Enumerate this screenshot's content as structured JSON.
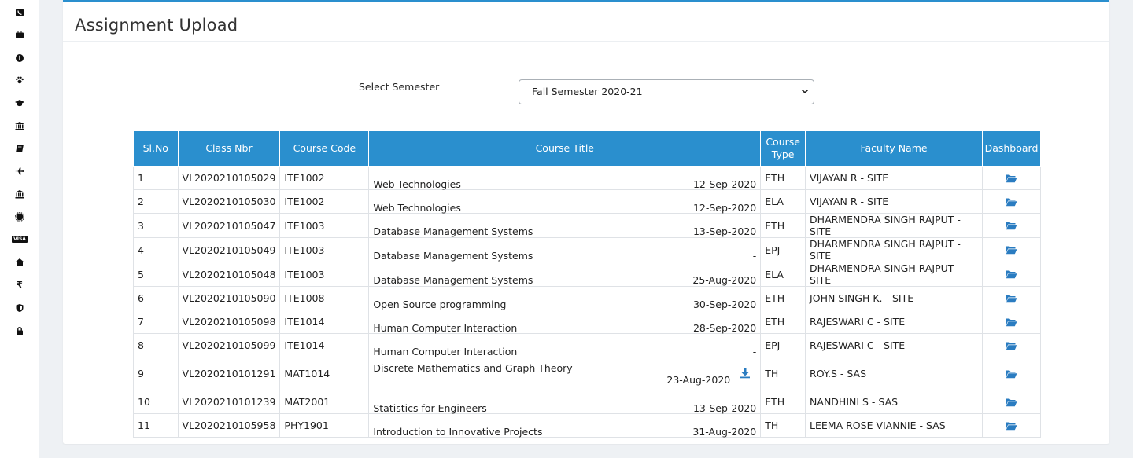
{
  "sidebar": {
    "icons": [
      "phone-icon",
      "briefcase-icon",
      "info-icon",
      "paw-icon",
      "graduation-cap-icon",
      "institution-icon",
      "book-icon",
      "plane-icon",
      "bank-icon",
      "certificate-icon",
      "visa-icon",
      "home-icon",
      "rupee-icon",
      "shield-icon",
      "lock-icon"
    ],
    "visa_text": "VISA",
    "rupee_text": "₹"
  },
  "page": {
    "title": "Assignment Upload"
  },
  "semester": {
    "label": "Select Semester",
    "selected": "Fall Semester 2020-21"
  },
  "table": {
    "headers": {
      "sl": "Sl.No",
      "class_nbr": "Class Nbr",
      "course_code": "Course Code",
      "course_title": "Course Title",
      "course_type_1": "Course",
      "course_type_2": "Type",
      "faculty": "Faculty Name",
      "dashboard": "Dashboard"
    },
    "rows": [
      {
        "sl": "1",
        "class_nbr": "VL2020210105029",
        "code": "ITE1002",
        "title": "Web Technologies",
        "date": "12-Sep-2020",
        "type": "ETH",
        "faculty": "VIJAYAN R - SITE"
      },
      {
        "sl": "2",
        "class_nbr": "VL2020210105030",
        "code": "ITE1002",
        "title": "Web Technologies",
        "date": "12-Sep-2020",
        "type": "ELA",
        "faculty": "VIJAYAN R - SITE"
      },
      {
        "sl": "3",
        "class_nbr": "VL2020210105047",
        "code": "ITE1003",
        "title": "Database Management Systems",
        "date": "13-Sep-2020",
        "type": "ETH",
        "faculty": "DHARMENDRA SINGH RAJPUT - SITE"
      },
      {
        "sl": "4",
        "class_nbr": "VL2020210105049",
        "code": "ITE1003",
        "title": "Database Management Systems",
        "date": "-",
        "type": "EPJ",
        "faculty": "DHARMENDRA SINGH RAJPUT - SITE"
      },
      {
        "sl": "5",
        "class_nbr": "VL2020210105048",
        "code": "ITE1003",
        "title": "Database Management Systems",
        "date": "25-Aug-2020",
        "type": "ELA",
        "faculty": "DHARMENDRA SINGH RAJPUT - SITE"
      },
      {
        "sl": "6",
        "class_nbr": "VL2020210105090",
        "code": "ITE1008",
        "title": "Open Source programming",
        "date": "30-Sep-2020",
        "type": "ETH",
        "faculty": "JOHN SINGH K. - SITE"
      },
      {
        "sl": "7",
        "class_nbr": "VL2020210105098",
        "code": "ITE1014",
        "title": "Human Computer Interaction",
        "date": "28-Sep-2020",
        "type": "ETH",
        "faculty": "RAJESWARI C - SITE"
      },
      {
        "sl": "8",
        "class_nbr": "VL2020210105099",
        "code": "ITE1014",
        "title": "Human Computer Interaction",
        "date": "-",
        "type": "EPJ",
        "faculty": "RAJESWARI C - SITE"
      },
      {
        "sl": "9",
        "class_nbr": "VL2020210101291",
        "code": "MAT1014",
        "title": "Discrete Mathematics and Graph Theory",
        "date": "23-Aug-2020",
        "type": "TH",
        "faculty": "ROY.S - SAS",
        "download": true
      },
      {
        "sl": "10",
        "class_nbr": "VL2020210101239",
        "code": "MAT2001",
        "title": "Statistics for Engineers",
        "date": "13-Sep-2020",
        "type": "ETH",
        "faculty": "NANDHINI S - SAS"
      },
      {
        "sl": "11",
        "class_nbr": "VL2020210105958",
        "code": "PHY1901",
        "title": "Introduction to Innovative Projects",
        "date": "31-Aug-2020",
        "type": "TH",
        "faculty": "LEEMA ROSE VIANNIE - SAS"
      }
    ]
  },
  "colors": {
    "accent": "#2a8fce",
    "icon_blue": "#2a7cc1"
  }
}
